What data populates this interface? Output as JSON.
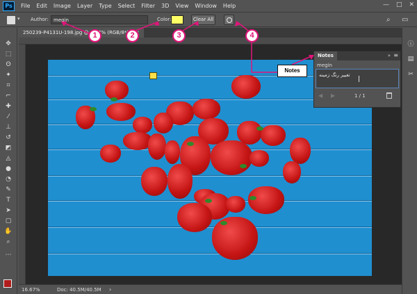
{
  "app": {
    "logo": "Ps"
  },
  "menu": [
    "File",
    "Edit",
    "Image",
    "Layer",
    "Type",
    "Select",
    "Filter",
    "3D",
    "View",
    "Window",
    "Help"
  ],
  "window_controls": [
    "—",
    "□",
    "✕"
  ],
  "options": {
    "author_label": "Author:",
    "author_value": "megin",
    "color_label": "Color:",
    "color_value": "#ffff66",
    "clear_label": "Clear All"
  },
  "document": {
    "tab_title": "250239-P4131U-198.jpg @ 16.7% (RGB/8*) *",
    "close": "×"
  },
  "notes_panel": {
    "tab": "Notes",
    "collapse": "»",
    "menu": "≡",
    "author": "megin",
    "text": "تغییر رنگ زمینه",
    "prev": "◀",
    "next": "▶",
    "count": "1 / 1"
  },
  "status": {
    "zoom": "16.67%",
    "doc_info": "Doc: 40.5M/40.5M",
    "arrow": "›"
  },
  "callouts": [
    "1",
    "2",
    "3",
    "4"
  ],
  "notes_label": "Notes",
  "icons": [
    "note-tool-icon",
    "search-icon",
    "workspace-icon",
    "info-icon",
    "history-icon",
    "tools-icon"
  ]
}
